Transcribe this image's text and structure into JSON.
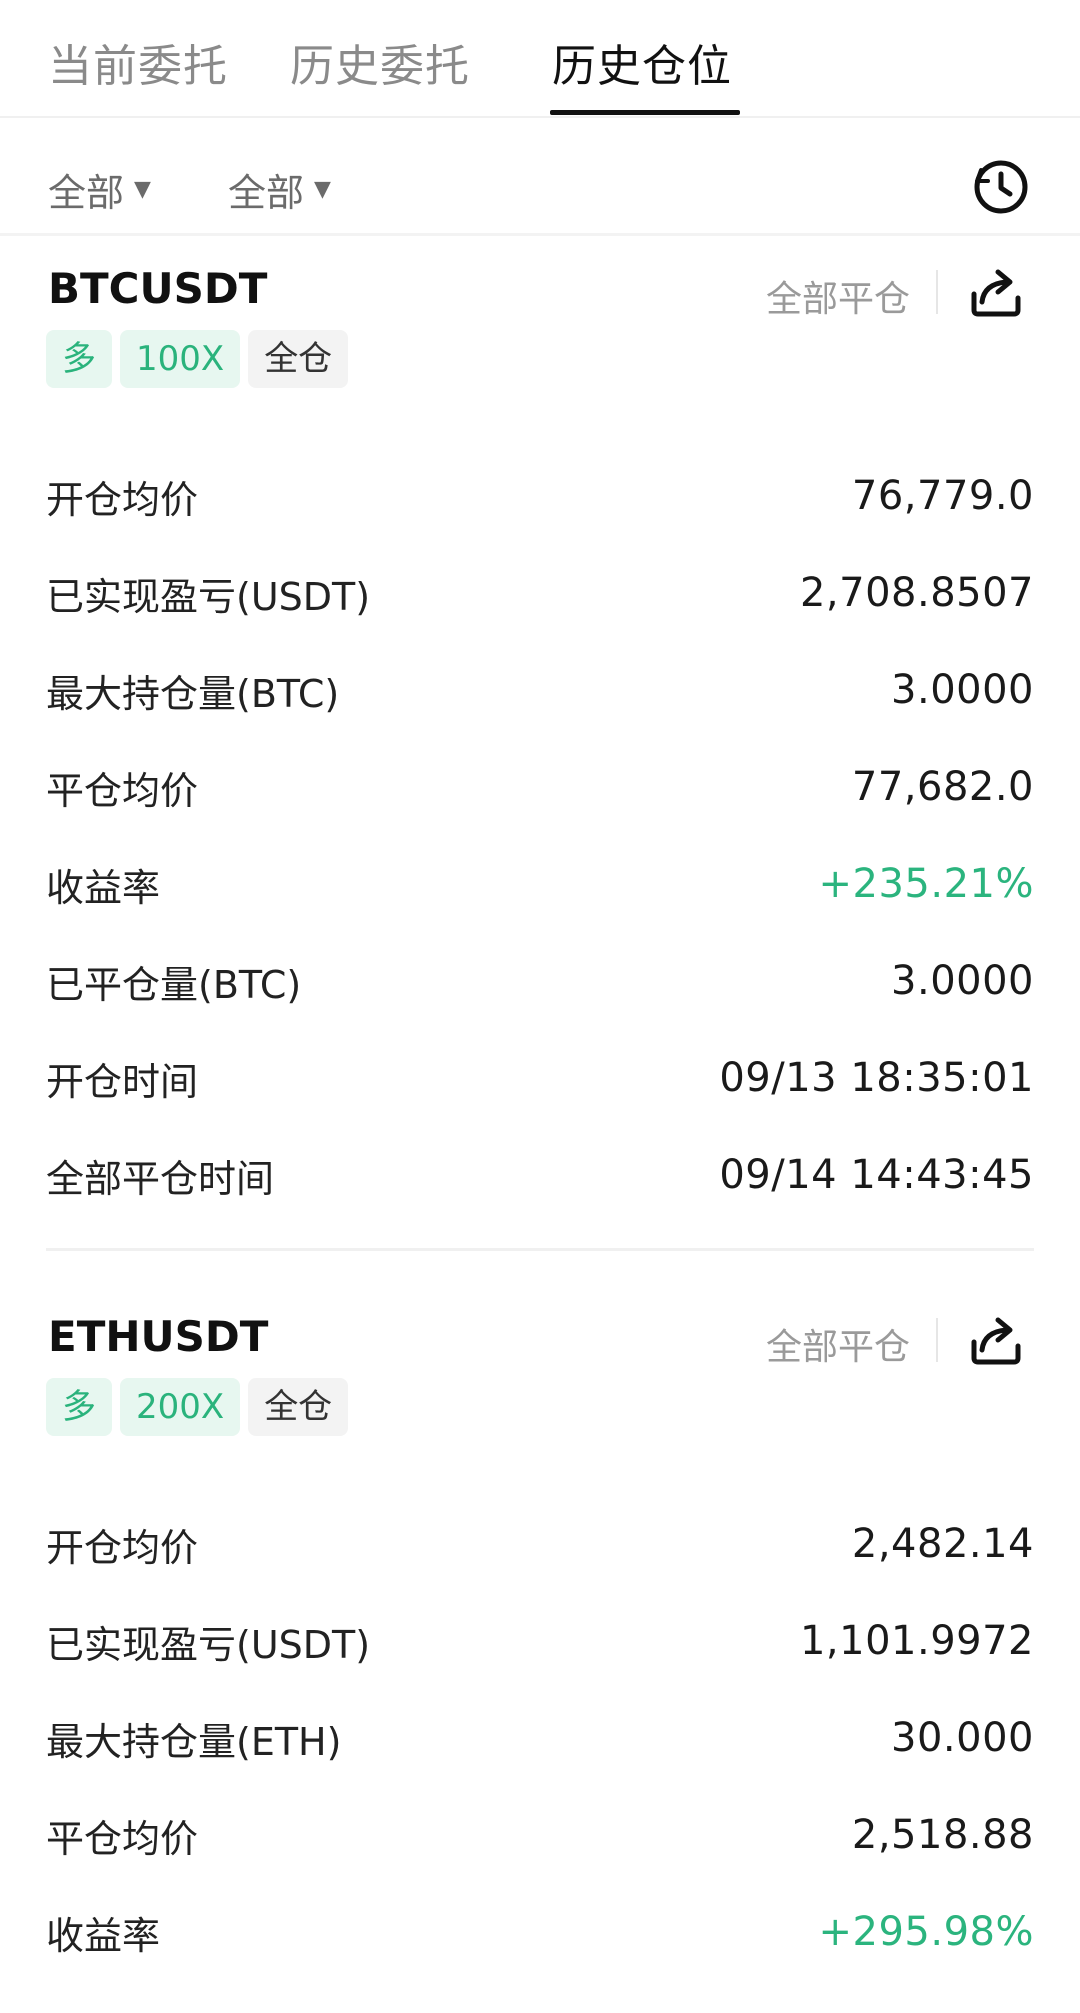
{
  "tabs": [
    {
      "label": "当前委托",
      "active": false
    },
    {
      "label": "历史委托",
      "active": false
    },
    {
      "label": "历史仓位",
      "active": true
    }
  ],
  "filters": {
    "type_label": "全部",
    "side_label": "全部",
    "history_icon": "clock-history-icon"
  },
  "colors": {
    "accent_green": "#2bb47e",
    "tag_green_bg": "#e7f7f0",
    "tag_gray_bg": "#f3f3f3"
  },
  "positions": [
    {
      "symbol": "BTCUSDT",
      "close_status": "全部平仓",
      "share_icon": "share-icon",
      "tags": {
        "side": "多",
        "leverage": "100X",
        "margin_mode": "全仓"
      },
      "fields": [
        {
          "label": "开仓均价",
          "value": "76,779.0"
        },
        {
          "label": "已实现盈亏(USDT)",
          "value": "2,708.8507"
        },
        {
          "label": "最大持仓量(BTC)",
          "value": "3.0000"
        },
        {
          "label": "平仓均价",
          "value": "77,682.0"
        },
        {
          "label": "收益率",
          "value": "+235.21%"
        },
        {
          "label": "已平仓量(BTC)",
          "value": "3.0000"
        },
        {
          "label": "开仓时间",
          "value": "09/13 18:35:01"
        },
        {
          "label": "全部平仓时间",
          "value": "09/14 14:43:45"
        }
      ]
    },
    {
      "symbol": "ETHUSDT",
      "close_status": "全部平仓",
      "share_icon": "share-icon",
      "tags": {
        "side": "多",
        "leverage": "200X",
        "margin_mode": "全仓"
      },
      "fields": [
        {
          "label": "开仓均价",
          "value": "2,482.14"
        },
        {
          "label": "已实现盈亏(USDT)",
          "value": "1,101.9972"
        },
        {
          "label": "最大持仓量(ETH)",
          "value": "30.000"
        },
        {
          "label": "平仓均价",
          "value": "2,518.88"
        },
        {
          "label": "收益率",
          "value": "+295.98%"
        }
      ]
    }
  ]
}
